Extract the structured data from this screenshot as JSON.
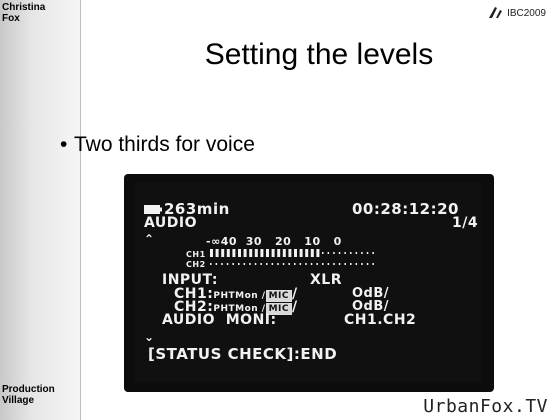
{
  "sidebar": {
    "top_label": "Christina\nFox",
    "bottom_label": "Production\nVillage"
  },
  "header": {
    "event_logo": "IBC2009"
  },
  "slide": {
    "title": "Setting the levels",
    "bullet": "Two thirds for voice"
  },
  "lcd": {
    "battery": "263min",
    "timecode": "00:28:12:20",
    "mode": "AUDIO",
    "page": "1/4",
    "scale": "-∞40  30   20   10   0",
    "ch1_label": "CH1",
    "ch2_label": "CH2",
    "input_label": "INPUT:",
    "input_value": "XLR",
    "ch1_row_prefix": "CH1:",
    "ch2_row_prefix": "CH2:",
    "phtmon": "PHTMon /",
    "mic": "MIC",
    "slash": "/",
    "odb": "OdB/",
    "audio_moni": "AUDIO  MONI:",
    "audio_moni_value": "CH1.CH2",
    "status": "[STATUS CHECK]:END",
    "ch1_level": 0.65,
    "ch2_level": 0.0
  },
  "footer": {
    "brand": "UrbanFox.TV"
  }
}
